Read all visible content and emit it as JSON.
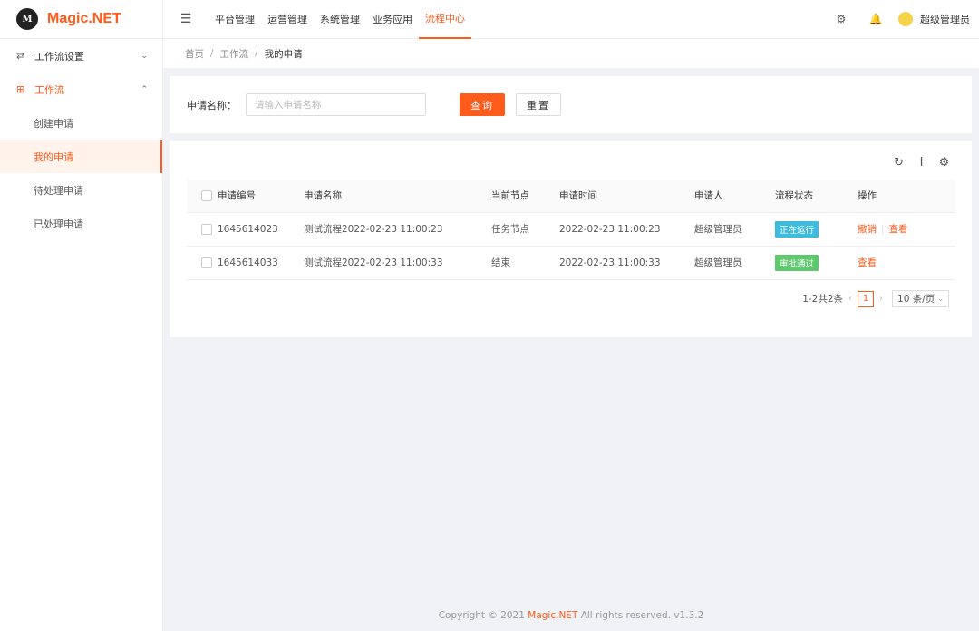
{
  "logo": {
    "mark": "M",
    "text": "Magic.NET"
  },
  "sidebar": {
    "groups": [
      {
        "icon": "⇄",
        "label": "工作流设置",
        "chevron": "⌄"
      },
      {
        "icon": "⊞",
        "label": "工作流",
        "chevron": "⌃"
      }
    ],
    "sub_items": [
      {
        "label": "创建申请"
      },
      {
        "label": "我的申请"
      },
      {
        "label": "待处理申请"
      },
      {
        "label": "已处理申请"
      }
    ]
  },
  "header": {
    "fold_icon": "☰",
    "nav": [
      "平台管理",
      "运营管理",
      "系统管理",
      "业务应用",
      "流程中心"
    ],
    "settings_icon": "⚙",
    "bell_icon": "🔔",
    "username": "超级管理员"
  },
  "breadcrumb": {
    "items": [
      "首页",
      "工作流"
    ],
    "current": "我的申请",
    "sep": "/"
  },
  "search": {
    "label": "申请名称：",
    "placeholder": "请输入申请名称",
    "value": "",
    "query_label": "查询",
    "reset_label": "重置"
  },
  "table": {
    "tools": {
      "refresh": "↻",
      "density": "Ι",
      "settings": "⚙"
    },
    "columns": [
      "申请编号",
      "申请名称",
      "当前节点",
      "申请时间",
      "申请人",
      "流程状态",
      "操作"
    ],
    "rows": [
      {
        "id": "1645614023",
        "name": "测试流程2022-02-23 11:00:23",
        "node": "任务节点",
        "time": "2022-02-23 11:00:23",
        "applicant": "超级管理员",
        "status": "正在运行",
        "ops": [
          "撤销",
          "查看"
        ]
      },
      {
        "id": "1645614033",
        "name": "测试流程2022-02-23 11:00:33",
        "node": "结束",
        "time": "2022-02-23 11:00:33",
        "applicant": "超级管理员",
        "status": "审批通过",
        "ops": [
          "查看"
        ]
      }
    ]
  },
  "pager": {
    "summary": "1-2共2条",
    "prev": "‹",
    "page": "1",
    "next": "›",
    "size": "10 条/页",
    "size_icon": "⌄"
  },
  "footer": {
    "prefix": "Copyright © 2021 ",
    "brand": "Magic.NET",
    "suffix": " All rights reserved. v1.3.2"
  },
  "colors": {
    "accent": "#ff5b1a",
    "running": "#3ebbdd",
    "approved": "#5cc96d"
  }
}
